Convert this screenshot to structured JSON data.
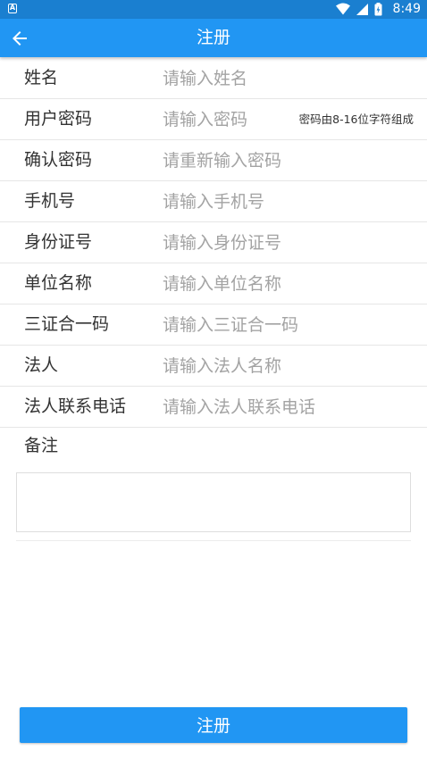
{
  "status_bar": {
    "time": "8:49",
    "notification_icon_letter": "A"
  },
  "header": {
    "title": "注册",
    "back_icon": "arrow-left-icon"
  },
  "fields": [
    {
      "label": "姓名",
      "placeholder": "请输入姓名",
      "value": ""
    },
    {
      "label": "用户密码",
      "placeholder": "请输入密码",
      "value": "",
      "hint": "密码由8-16位字符组成"
    },
    {
      "label": "确认密码",
      "placeholder": "请重新输入密码",
      "value": ""
    },
    {
      "label": "手机号",
      "placeholder": "请输入手机号",
      "value": ""
    },
    {
      "label": "身份证号",
      "placeholder": "请输入身份证号",
      "value": ""
    },
    {
      "label": "单位名称",
      "placeholder": "请输入单位名称",
      "value": ""
    },
    {
      "label": "三证合一码",
      "placeholder": "请输入三证合一码",
      "value": ""
    },
    {
      "label": "法人",
      "placeholder": "请输入法人名称",
      "value": ""
    },
    {
      "label": "法人联系电话",
      "placeholder": "请输入法人联系电话",
      "value": ""
    }
  ],
  "remark": {
    "label": "备注",
    "value": ""
  },
  "submit": {
    "label": "注册"
  },
  "colors": {
    "primary": "#2196f3",
    "status_bar": "#1a7fd0",
    "placeholder": "#a3a3a3",
    "text": "#333333"
  }
}
